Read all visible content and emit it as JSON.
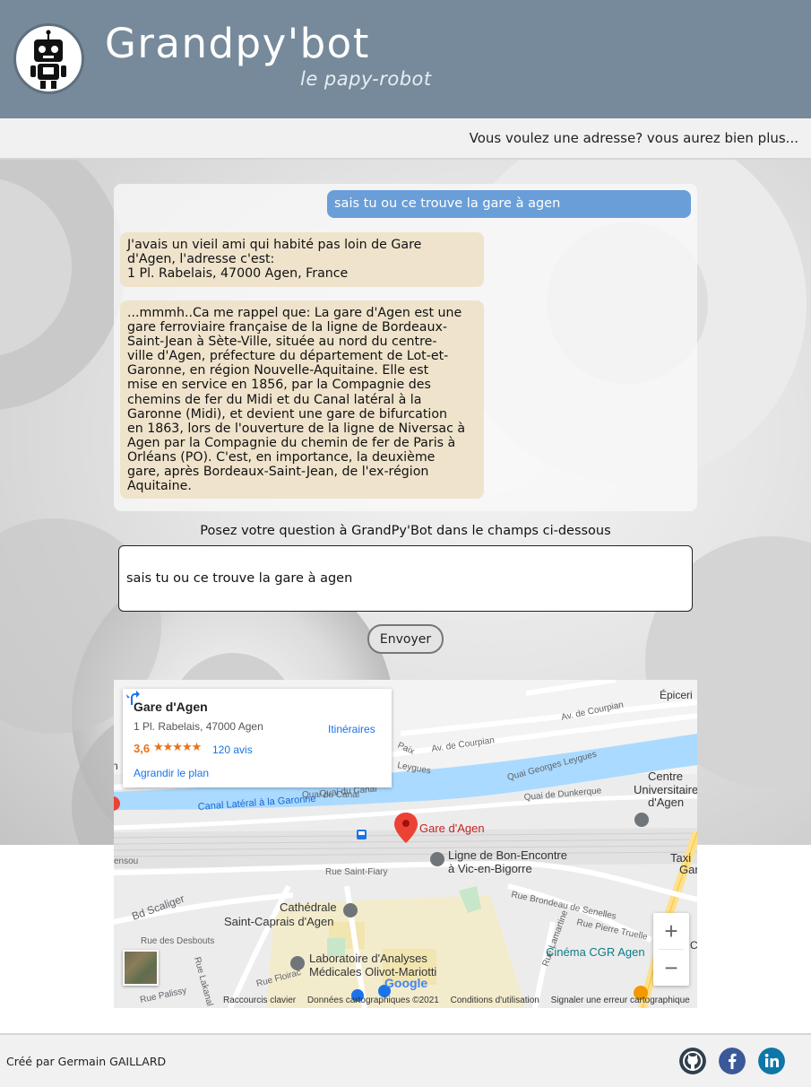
{
  "header": {
    "title": "Grandpy'bot",
    "subtitle": "le papy-robot",
    "tagline": "Vous voulez une adresse? vous aurez bien plus..."
  },
  "chat": {
    "user_message": "sais tu ou ce trouve la gare à agen",
    "bot_address_lines": [
      "J'avais un vieil ami qui habité pas loin de Gare",
      "d'Agen, l'adresse c'est:",
      "1 Pl. Rabelais, 47000 Agen, France"
    ],
    "bot_story_lines": [
      "...mmmh..Ca me rappel que: La gare d'Agen est une",
      "gare ferroviaire française de la ligne de Bordeaux-",
      "Saint-Jean à Sète-Ville, située au nord du centre-",
      "ville d'Agen, préfecture du département de Lot-et-",
      "Garonne, en région Nouvelle-Aquitaine. Elle est",
      "mise en service en 1856, par la Compagnie des",
      "chemins de fer du Midi et du Canal latéral à la",
      "Garonne (Midi), et devient une gare de bifurcation",
      "en 1863, lors de l'ouverture de la ligne de Niversac à",
      "Agen par la Compagnie du chemin de fer de Paris à",
      "Orléans (PO). C'est, en importance, la deuxième",
      "gare, après Bordeaux-Saint-Jean, de l'ex-région",
      "Aquitaine."
    ]
  },
  "form": {
    "prompt": "Posez votre question à GrandPy'Bot dans le champs ci-dessous",
    "input_value": "sais tu ou ce trouve la gare à agen",
    "send_label": "Envoyer"
  },
  "map": {
    "place_name": "Gare d'Agen",
    "place_address": "1 Pl. Rabelais, 47000 Agen",
    "rating": "3,6",
    "stars": "★★★★★",
    "reviews": "120 avis",
    "enlarge": "Agrandir le plan",
    "directions": "Itinéraires",
    "zoom_in": "+",
    "zoom_out": "−",
    "google_logo": "Google",
    "footer_links": [
      "Raccourcis clavier",
      "Données cartographiques ©2021",
      "Conditions d'utilisation",
      "Signaler une erreur cartographique"
    ],
    "labels": {
      "marker": "Gare d'Agen",
      "epicerie": "Épiceri",
      "av_courpian_1": "Av. de Courpian",
      "av_courpian_2": "Av. de Courpian",
      "paix": "Paix",
      "leygues_1": "Leygues",
      "leygues_2": "Quai Georges Leygues",
      "centre_univ_1": "Centre",
      "centre_univ_2": "Universitaire",
      "centre_univ_3": "d'Agen",
      "quai_dunkerque": "Quai de Dunkerque",
      "quai_canal_1": "Quai du Canal",
      "quai_canal_2": "Quai du Canal",
      "canal_lateral": "Canal Latéral à la Garonne",
      "ligne_1": "Ligne de Bon-Encontre",
      "ligne_2": "à Vic-en-Bigorre",
      "taxi_1": "Taxi",
      "taxi_2": "Gar",
      "rue_saint_fiacre": "Rue Saint-Fiary",
      "bd_scaliger": "Bd Scaliger",
      "cathedrale_1": "Cathédrale",
      "cathedrale_2": "Saint-Caprais d'Agen",
      "rue_desbouts": "Rue des Desbouts",
      "rue_lakanal": "Rue Lakanal",
      "rue_brondeau": "Rue Brondeau de Senelles",
      "rue_truelle": "Rue Pierre Truelle",
      "rue_lamartine": "Rue Lamartine",
      "cinema": "Cinéma CGR Agen",
      "labo_1": "Laboratoire d'Analyses",
      "labo_2": "Médicales Olivot-Mariotti",
      "rue_floirac": "Rue Floirac",
      "rue_palissy": "Rue Palissy",
      "ensou": "ensou",
      "n": "n",
      "c": "C"
    }
  },
  "footer": {
    "credit": "Créé par Germain GAILLARD",
    "social": [
      "github-icon",
      "facebook-icon",
      "linkedin-icon"
    ]
  },
  "colors": {
    "header_bg": "#778a9b",
    "user_bubble": "#6a9ed8",
    "bot_bubble": "#efe3cc",
    "river": "#aadaff",
    "marker": "#ea4335"
  }
}
